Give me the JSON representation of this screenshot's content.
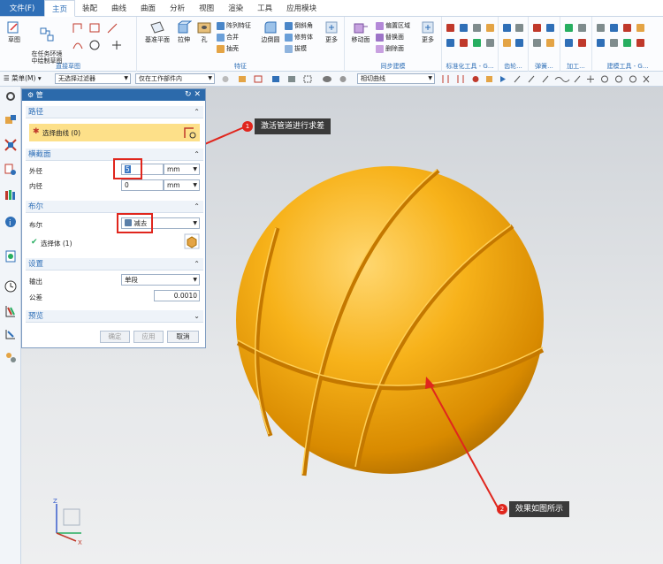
{
  "menu": {
    "file": "文件(F)",
    "tabs": [
      "主页",
      "装配",
      "曲线",
      "曲面",
      "分析",
      "视图",
      "渲染",
      "工具",
      "应用模块"
    ]
  },
  "ribbon": {
    "sketch_label": "草图",
    "task_sketch_label": "在任务环境\n中绘制草图",
    "direct_sketch_title": "直接草图",
    "datum_plane_label": "基准平面",
    "extrude_label": "拉伸",
    "hole_label": "孔",
    "pattern_feature_label": "阵列特征",
    "unite_label": "合并",
    "shell_label": "抽壳",
    "edge_blend_label": "边倒圆",
    "chamfer_label": "倒斜角",
    "trim_body_label": "修剪体",
    "draft_label": "拔模",
    "more_label_1": "更多",
    "feature_title": "特征",
    "move_face_label": "移动面",
    "offset_region_label": "偏置区域",
    "replace_face_label": "替换面",
    "delete_face_label": "删除面",
    "more_label_2": "更多",
    "sync_title": "同步建模",
    "std_tools_title": "标准化工具 - G...",
    "gear_title": "齿轮...",
    "spring_title": "弹簧...",
    "machining_title": "加工...",
    "modeling_tools_title": "建模工具 - G..."
  },
  "toolbar2": {
    "menu_label": "菜单(M)",
    "filter": "无选择过滤器",
    "scope": "仅在工作部件内",
    "curve_rule": "相切曲线"
  },
  "dialog": {
    "title": "管",
    "path_title": "路径",
    "select_curve": "选择曲线 (0)",
    "cross_section_title": "横截面",
    "outer_diameter_label": "外径",
    "outer_diameter_value": "5",
    "outer_unit": "mm",
    "inner_diameter_label": "内径",
    "inner_diameter_value": "0",
    "inner_unit": "mm",
    "boolean_title": "布尔",
    "boolean_label": "布尔",
    "boolean_value": "减去",
    "select_body": "选择体 (1)",
    "settings_title": "设置",
    "output_label": "输出",
    "output_value": "单段",
    "tolerance_label": "公差",
    "tolerance_value": "0.0010",
    "preview_title": "预览",
    "ok_label": "确定",
    "apply_label": "应用",
    "cancel_label": "取消"
  },
  "callouts": [
    {
      "number": "1",
      "text": "激活管道进行求差"
    },
    {
      "number": "2",
      "text": "效果如图所示"
    }
  ],
  "colors": {
    "accent": "#2f6fb7",
    "title_bar": "#2c6aab",
    "highlight_row": "#fde089",
    "annotation_red": "#e0261d",
    "ball": "#f2a900"
  }
}
